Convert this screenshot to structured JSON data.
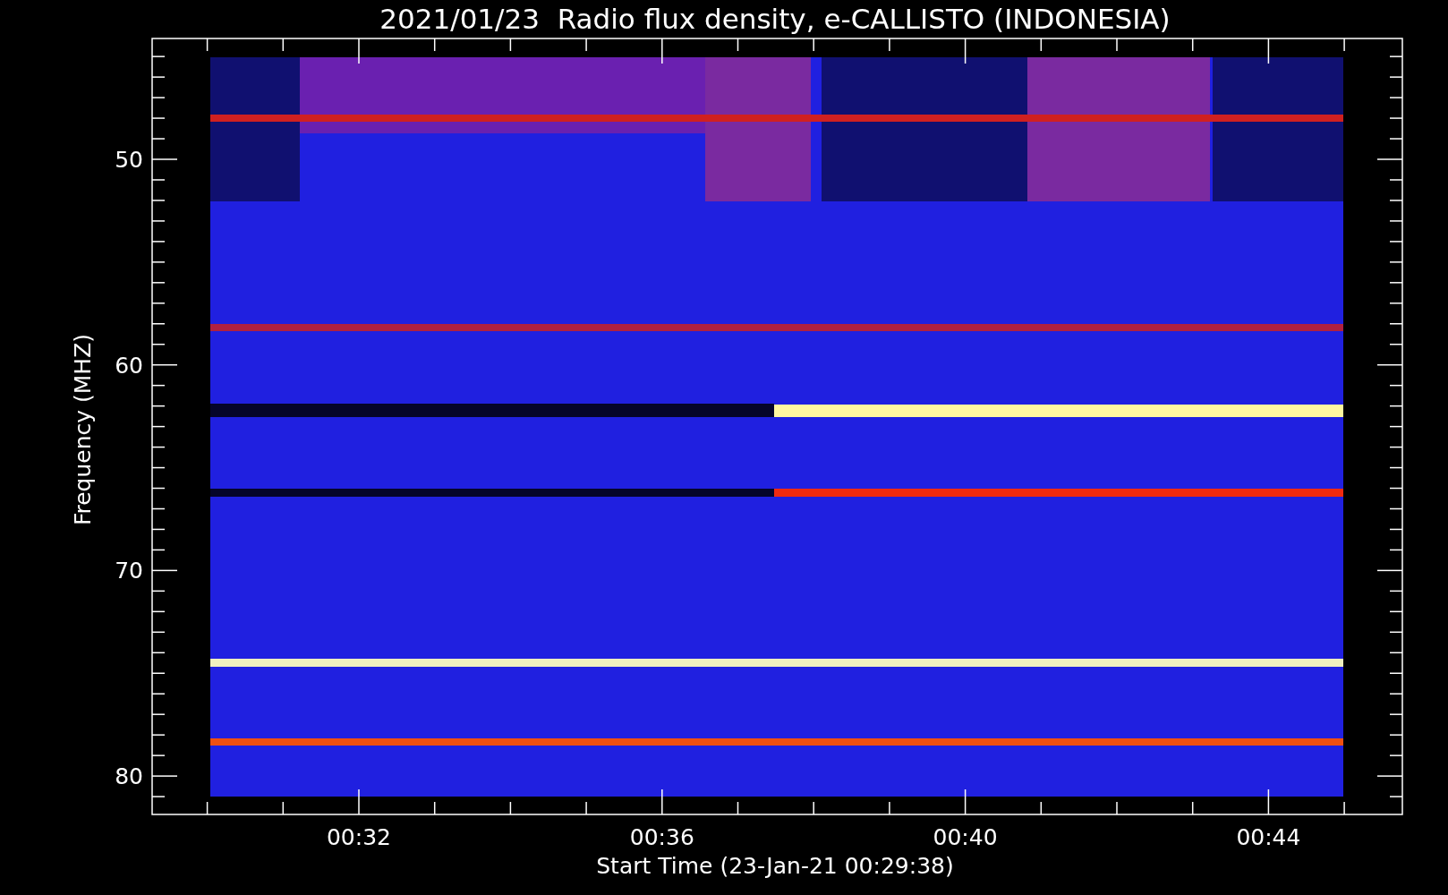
{
  "chart": {
    "title": "2021/01/23  Radio flux density, e-CALLISTO (INDONESIA)",
    "ylabel": "Frequency (MHZ)",
    "xlabel": "Start Time (23-Jan-21 00:29:38)",
    "yticks": [
      "50",
      "60",
      "70",
      "80"
    ],
    "xticks": [
      "00:32",
      "00:36",
      "00:40",
      "00:44"
    ]
  }
}
